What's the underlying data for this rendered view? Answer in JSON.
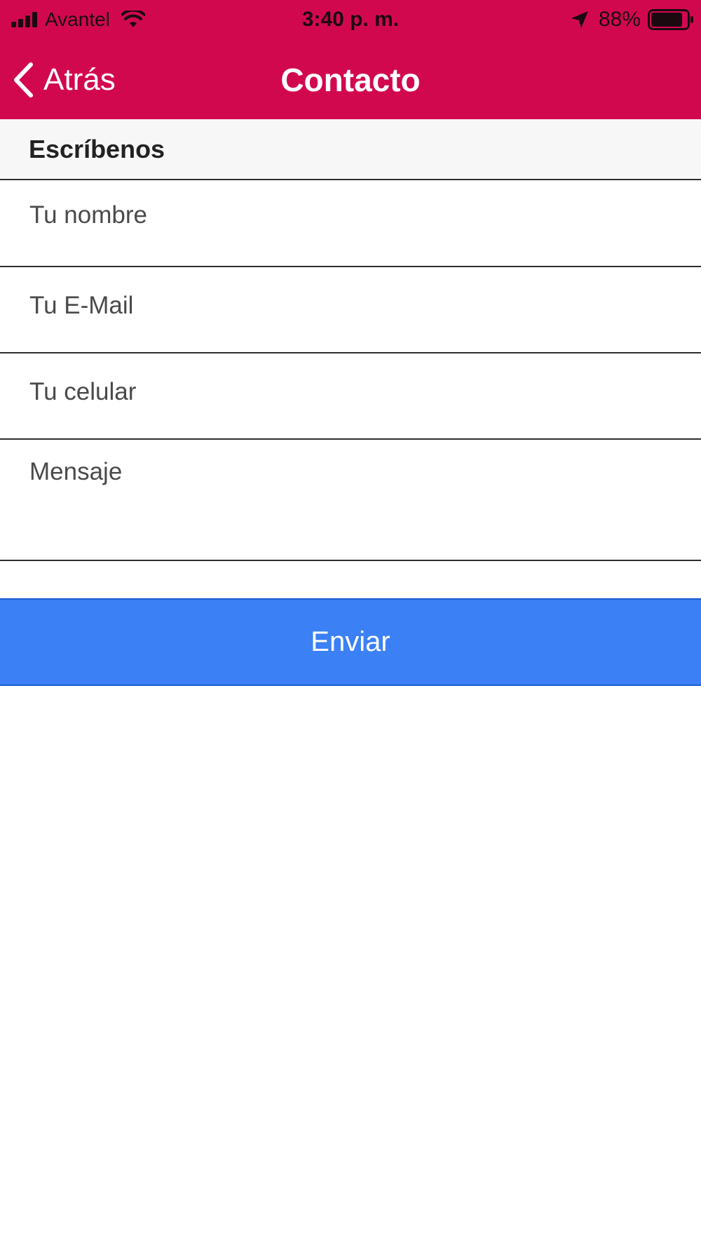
{
  "status_bar": {
    "carrier": "Avantel",
    "time": "3:40 p. m.",
    "battery_percent": "88%",
    "battery_level": 0.88,
    "icons": [
      "signal-icon",
      "wifi-icon",
      "location-arrow-icon",
      "battery-icon"
    ]
  },
  "nav": {
    "back_label": "Atrás",
    "title": "Contacto",
    "back_icon": "chevron-left-icon"
  },
  "form": {
    "section_title": "Escríbenos",
    "name_placeholder": "Tu nombre",
    "email_placeholder": "Tu E-Mail",
    "phone_placeholder": "Tu celular",
    "message_placeholder": "Mensaje",
    "submit_label": "Enviar"
  },
  "colors": {
    "header_bg": "#d2084f",
    "button_bg": "#3b80f5",
    "section_bg": "#f7f7f7"
  }
}
